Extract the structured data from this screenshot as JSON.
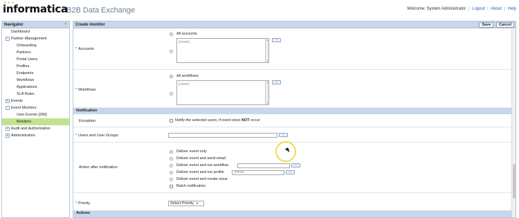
{
  "header": {
    "logo_text": "informatica",
    "logo_dots": "• • •",
    "product": "B2B Data Exchange",
    "welcome": "Welcome: System Administrator",
    "links": [
      "Logout",
      "About",
      "Help"
    ],
    "separator": "|"
  },
  "navigator": {
    "title": "Navigator",
    "collapse": "‹",
    "items": [
      {
        "label": "Dashboard"
      },
      {
        "label": "Partner Management"
      },
      {
        "label": "Onboarding"
      },
      {
        "label": "Partners"
      },
      {
        "label": "Portal Users"
      },
      {
        "label": "Profiles"
      },
      {
        "label": "Endpoints"
      },
      {
        "label": "Workflows"
      },
      {
        "label": "Applications"
      },
      {
        "label": "SLA Rules"
      },
      {
        "label": "Events"
      },
      {
        "label": "Event Monitors"
      },
      {
        "label": "User Events [266]"
      },
      {
        "label": "Monitors"
      },
      {
        "label": "Audit and Authorization"
      },
      {
        "label": "Administration"
      }
    ],
    "tree_expand": "+",
    "tree_collapse": "−"
  },
  "main": {
    "title": "Create monitor",
    "save_label": "Save",
    "cancel_label": "Cancel",
    "accounts": {
      "label": "Accounts",
      "all_label": "All accounts",
      "list_value": "(none)"
    },
    "workflows": {
      "label": "Workflows",
      "all_label": "All workflows",
      "list_value": "(none)"
    },
    "notification_section": "Notification",
    "exception": {
      "label": "Exception",
      "text_before": "Notify the selected users, if event does ",
      "text_bold": "NOT",
      "text_after": " occur"
    },
    "users": {
      "label": "Users and User Groups"
    },
    "action": {
      "label": "Action after notification",
      "options": [
        "Deliver event only",
        "Deliver event and send email",
        "Deliver event and run workflow",
        "Deliver event and run profile",
        "Deliver event and create issue"
      ],
      "profile_value": "(none)",
      "batch_label": "Batch notification"
    },
    "priority": {
      "label": "Priority",
      "value": "Select Priority"
    },
    "actions_section": "Actions",
    "ellipsis": "..."
  }
}
